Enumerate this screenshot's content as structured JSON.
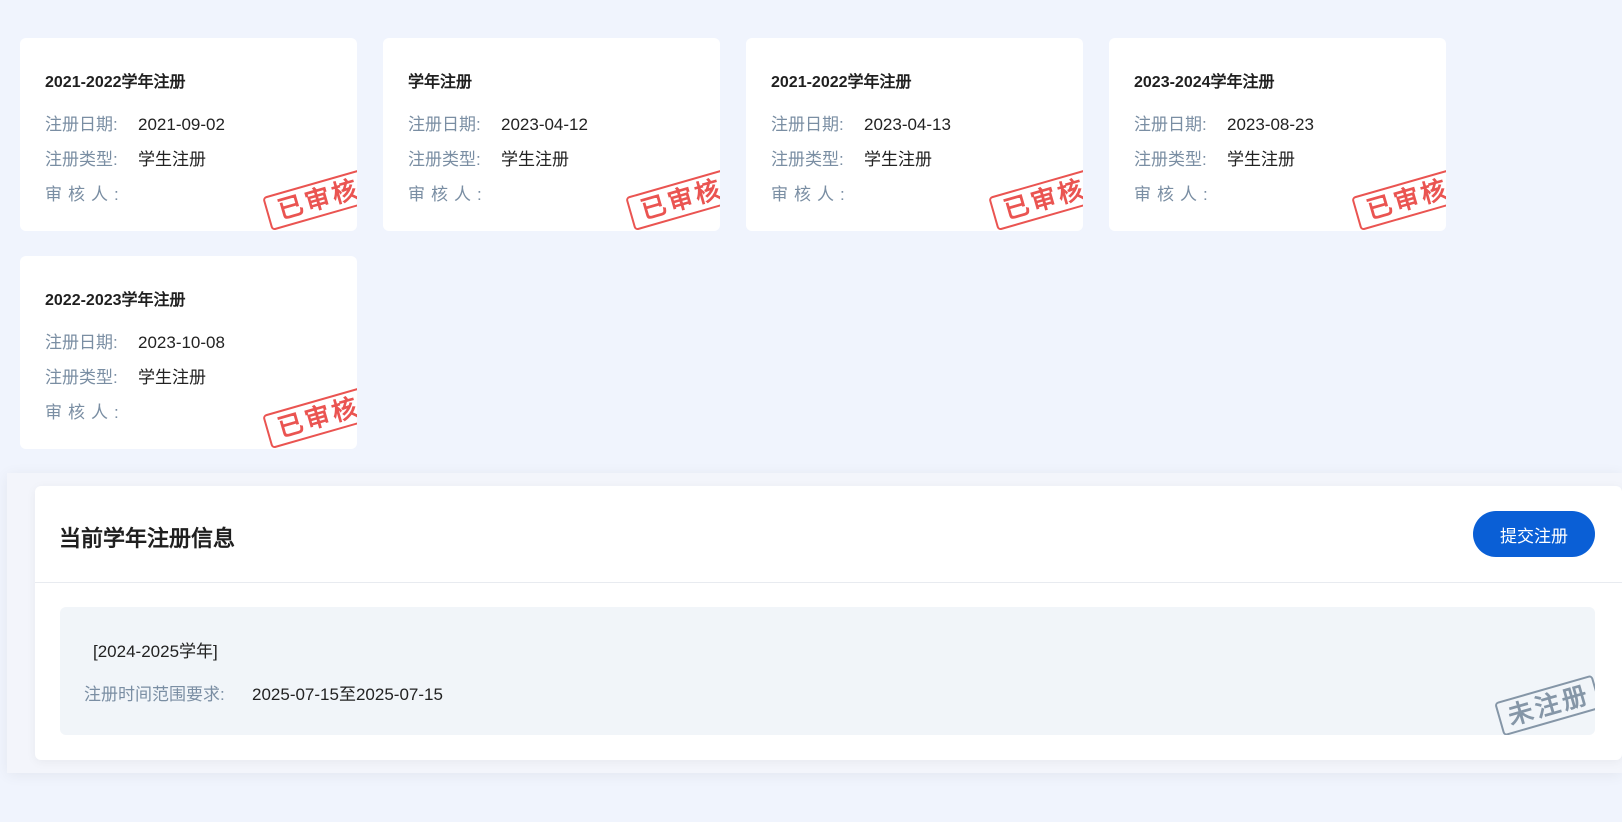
{
  "labels": {
    "date": "注册日期:",
    "type": "注册类型:",
    "reviewer": "审核人:"
  },
  "cards": [
    {
      "title": "2021-2022学年注册",
      "date": "2021-09-02",
      "type": "学生注册",
      "reviewer": "",
      "status": "已审核"
    },
    {
      "title": "学年注册",
      "date": "2023-04-12",
      "type": "学生注册",
      "reviewer": "",
      "status": "已审核"
    },
    {
      "title": "2021-2022学年注册",
      "date": "2023-04-13",
      "type": "学生注册",
      "reviewer": "",
      "status": "已审核"
    },
    {
      "title": "2023-2024学年注册",
      "date": "2023-08-23",
      "type": "学生注册",
      "reviewer": "",
      "status": "已审核"
    },
    {
      "title": "2022-2023学年注册",
      "date": "2023-10-08",
      "type": "学生注册",
      "reviewer": "",
      "status": "已审核"
    }
  ],
  "current": {
    "title": "当前学年注册信息",
    "submit_label": "提交注册",
    "year": "[2024-2025学年]",
    "range_label": "注册时间范围要求:",
    "range_value": "2025-07-15至2025-07-15",
    "status": "未注册"
  },
  "colors": {
    "page_bg": "#f0f4fd",
    "primary": "#0a5fd6",
    "stamp_approved": "#e8423f",
    "stamp_unregistered": "#8596a7",
    "label": "#7a8ea3"
  }
}
